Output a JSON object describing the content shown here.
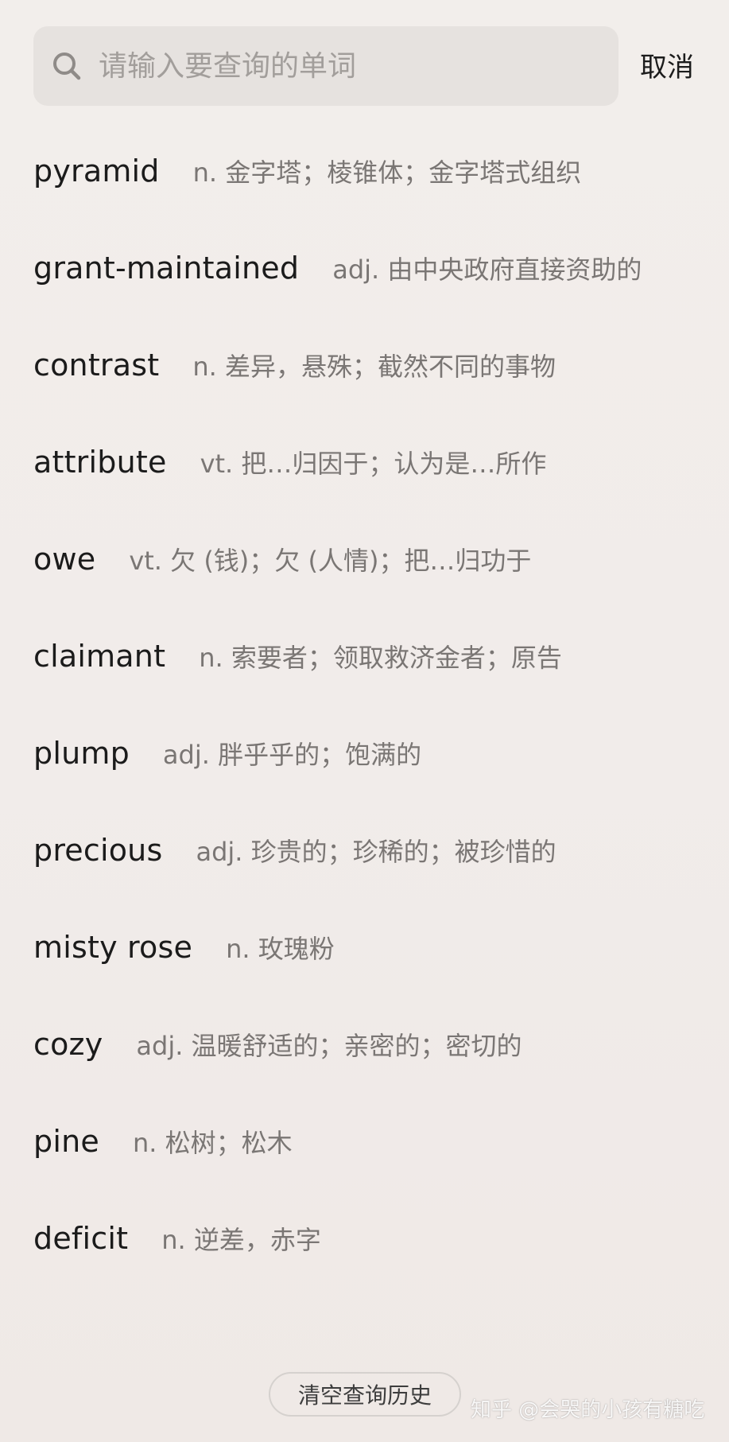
{
  "search": {
    "placeholder": "请输入要查询的单词",
    "value": "",
    "icon": "search-icon",
    "cancel_label": "取消"
  },
  "history": [
    {
      "word": "pyramid",
      "definition": "n. 金字塔；棱锥体；金字塔式组织"
    },
    {
      "word": "grant-maintained",
      "definition": "adj. 由中央政府直接资助的"
    },
    {
      "word": "contrast",
      "definition": "n. 差异，悬殊；截然不同的事物"
    },
    {
      "word": "attribute",
      "definition": "vt. 把…归因于；认为是…所作"
    },
    {
      "word": "owe",
      "definition": "vt. 欠 (钱)；欠 (人情)；把…归功于"
    },
    {
      "word": "claimant",
      "definition": "n. 索要者；领取救济金者；原告"
    },
    {
      "word": "plump",
      "definition": "adj. 胖乎乎的；饱满的"
    },
    {
      "word": "precious",
      "definition": "adj. 珍贵的；珍稀的；被珍惜的"
    },
    {
      "word": "misty rose",
      "definition": "n. 玫瑰粉"
    },
    {
      "word": "cozy",
      "definition": "adj. 温暖舒适的；亲密的；密切的"
    },
    {
      "word": "pine",
      "definition": "n. 松树；松木"
    },
    {
      "word": "deficit",
      "definition": "n. 逆差，赤字"
    }
  ],
  "clear_history_label": "清空查询历史",
  "watermark": "知乎 @会哭的小孩有糖吃",
  "colors": {
    "background": "#f1ecea",
    "search_bg": "#e6e2df",
    "word": "#1b1b1b",
    "definition": "#7a7674",
    "placeholder": "#a29e9b"
  }
}
